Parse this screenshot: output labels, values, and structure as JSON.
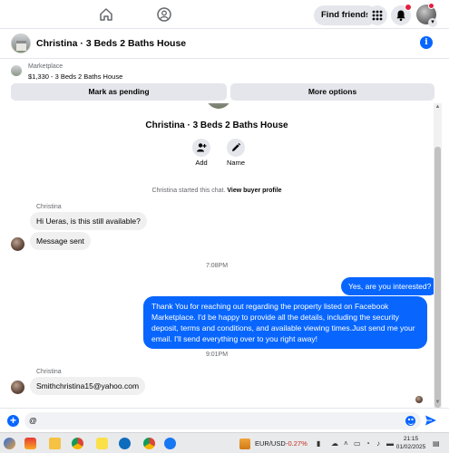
{
  "topbar": {
    "find_friends": "Find friends",
    "icons": [
      "home-icon",
      "groups-icon",
      "menu-grid-icon",
      "bell-icon"
    ]
  },
  "chat": {
    "title": "Christina · 3 Beds 2 Baths House"
  },
  "listing": {
    "label": "Marketplace",
    "price_title": "$1,330 - 3 Beds 2 Baths House",
    "mark_pending": "Mark as pending",
    "more_options": "More options"
  },
  "thread": {
    "hero_title": "Christina · 3 Beds 2 Baths House",
    "action_add": "Add",
    "action_name": "Name",
    "started_prefix": "Christina started this chat.",
    "view_profile": "View buyer profile",
    "messages": [
      {
        "sender": "Christina",
        "text": "Hi Ueras, is this still available?"
      },
      {
        "text": "Message sent"
      },
      {
        "time": "7:08PM"
      },
      {
        "text": "Yes, are you interested?"
      },
      {
        "text": "Thank You for reaching out regarding the property listed on Facebook Marketplace. I'd be happy to provide all the details, including the security deposit, terms and conditions, and available viewing times.Just send me your email. I'll send everything over to you right away!"
      },
      {
        "time": "9:01PM"
      },
      {
        "sender": "Christina",
        "text": "Smithchristina15@yahoo.com"
      }
    ]
  },
  "composer": {
    "value": "@"
  },
  "taskbar": {
    "ticker_name": "EUR/USD",
    "ticker_change": "-0.27%",
    "time": "21:15",
    "date": "01/02/2025"
  },
  "colors": {
    "accent": "#0866ff",
    "bubble_in": "#f0f0f0",
    "button_gray": "#e4e6eb",
    "notification": "#e41e3f"
  }
}
